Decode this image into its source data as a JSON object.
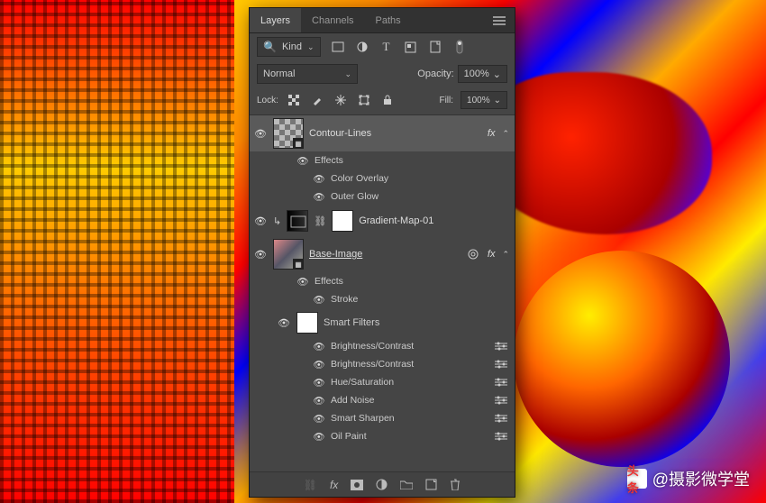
{
  "attribution": {
    "badge": "头条",
    "text": "@摄影微学堂"
  },
  "panel": {
    "tabs": [
      "Layers",
      "Channels",
      "Paths"
    ],
    "activeTab": 0,
    "filter": {
      "label": "Kind"
    },
    "blend": {
      "mode": "Normal",
      "opacityLabel": "Opacity:",
      "opacityValue": "100%"
    },
    "lock": {
      "label": "Lock:",
      "fillLabel": "Fill:",
      "fillValue": "100%"
    },
    "layers": [
      {
        "name": "Contour-Lines",
        "selected": true,
        "hasFx": true,
        "effectsLabel": "Effects",
        "effects": [
          "Color Overlay",
          "Outer Glow"
        ]
      },
      {
        "name": "Gradient-Map-01",
        "clipped": true
      },
      {
        "name": "Base-Image ",
        "underline": true,
        "smartObject": true,
        "hasFx": true,
        "effectsLabel": "Effects",
        "effects": [
          "Stroke"
        ],
        "smartFiltersLabel": "Smart Filters",
        "smartFilters": [
          "Brightness/Contrast",
          "Brightness/Contrast",
          "Hue/Saturation",
          "Add Noise",
          "Smart Sharpen",
          "Oil Paint"
        ]
      }
    ]
  }
}
